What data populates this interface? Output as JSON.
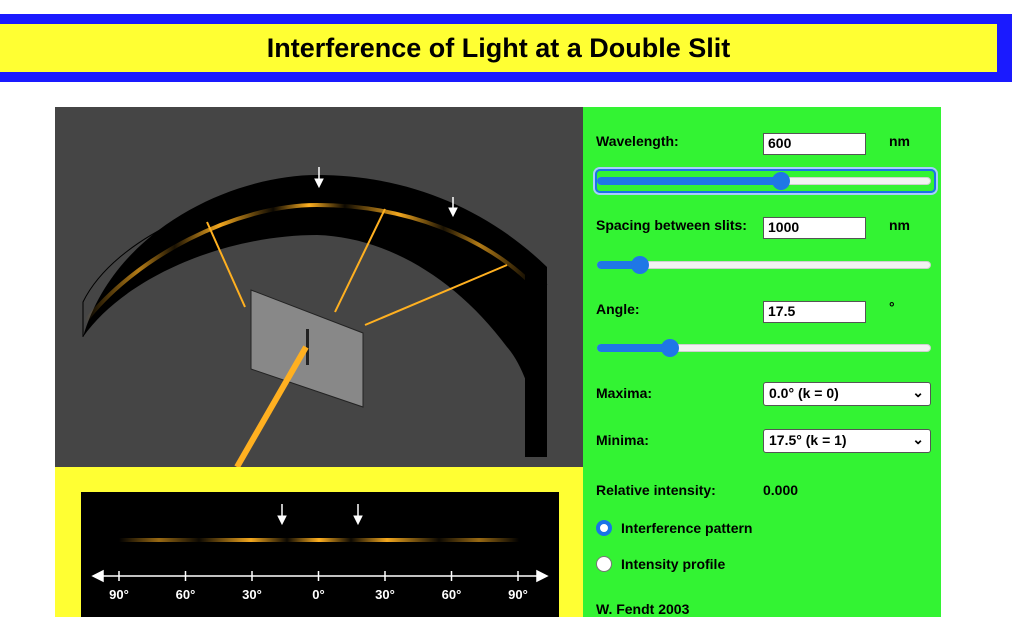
{
  "header": {
    "title": "Interference of Light at a Double Slit"
  },
  "controls": {
    "wavelength": {
      "label": "Wavelength:",
      "value": "600",
      "unit": "nm",
      "slider_fraction": 0.55
    },
    "spacing": {
      "label": "Spacing between slits:",
      "value": "1000",
      "unit": "nm",
      "slider_fraction": 0.13
    },
    "angle": {
      "label": "Angle:",
      "value": "17.5",
      "unit": "°",
      "slider_fraction": 0.22
    },
    "maxima": {
      "label": "Maxima:",
      "selected": "0.0° (k = 0)"
    },
    "minima": {
      "label": "Minima:",
      "selected": "17.5° (k = 1)"
    },
    "relative_intensity": {
      "label": "Relative intensity:",
      "value": "0.000"
    },
    "display_mode": {
      "options": [
        {
          "label": "Interference pattern",
          "selected": true
        },
        {
          "label": "Intensity profile",
          "selected": false
        }
      ]
    },
    "credit": "W. Fendt 2003"
  },
  "scale": {
    "ticks": [
      "90°",
      "60°",
      "30°",
      "0°",
      "30°",
      "60°",
      "90°"
    ]
  },
  "colors": {
    "header_border": "#1a1aff",
    "header_bg": "#ffff33",
    "panel_bg": "#33f333",
    "light": "#ffb020",
    "accent": "#1f77e6"
  }
}
